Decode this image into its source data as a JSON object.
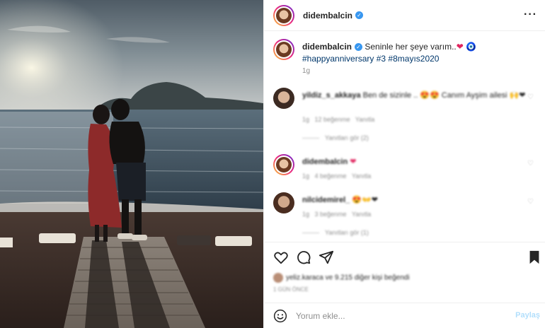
{
  "post": {
    "username": "didembalcin",
    "verified_icon": "verified-badge-icon",
    "more_icon": "more-options-icon"
  },
  "caption": {
    "username": "didembalcin",
    "text": "Seninle her şeye varım..",
    "heart_emoji": "❤",
    "evil_eye_emoji": "🧿",
    "hashtags_line1": "#happyanniversary",
    "hashtags_line2": "#3 #8mayıs2020",
    "time": "1g"
  },
  "comments": [
    {
      "username": "yildiz_s_akkaya",
      "text": "Ben de sizinle .. 😍😍 Canım Ayşim ailesi 🙌❤",
      "time": "1g",
      "likes": "12 beğenme",
      "reply": "Yanıtla",
      "view_replies": "Yanıtları gör (2)"
    },
    {
      "username": "didembalcin",
      "text": "❤",
      "time": "1g",
      "likes": "4 beğenme",
      "reply": "Yanıtla"
    },
    {
      "username": "nilcidemirel_",
      "text": "😍👐❤",
      "time": "1g",
      "likes": "3 beğenme",
      "reply": "Yanıtla",
      "view_replies": "Yanıtları gör (1)"
    }
  ],
  "likes_text": "yeliz.karaca ve 9.215 diğer kişi beğendi",
  "post_date": "1 GÜN ÖNCE",
  "add_comment": {
    "placeholder": "Yorum ekle...",
    "post_label": "Paylaş"
  },
  "colors": {
    "accent": "#3897f0",
    "hashtag": "#00376b",
    "heart": "#e0245e",
    "post_disabled": "#b2dffc",
    "muted": "#8e8e8e"
  }
}
